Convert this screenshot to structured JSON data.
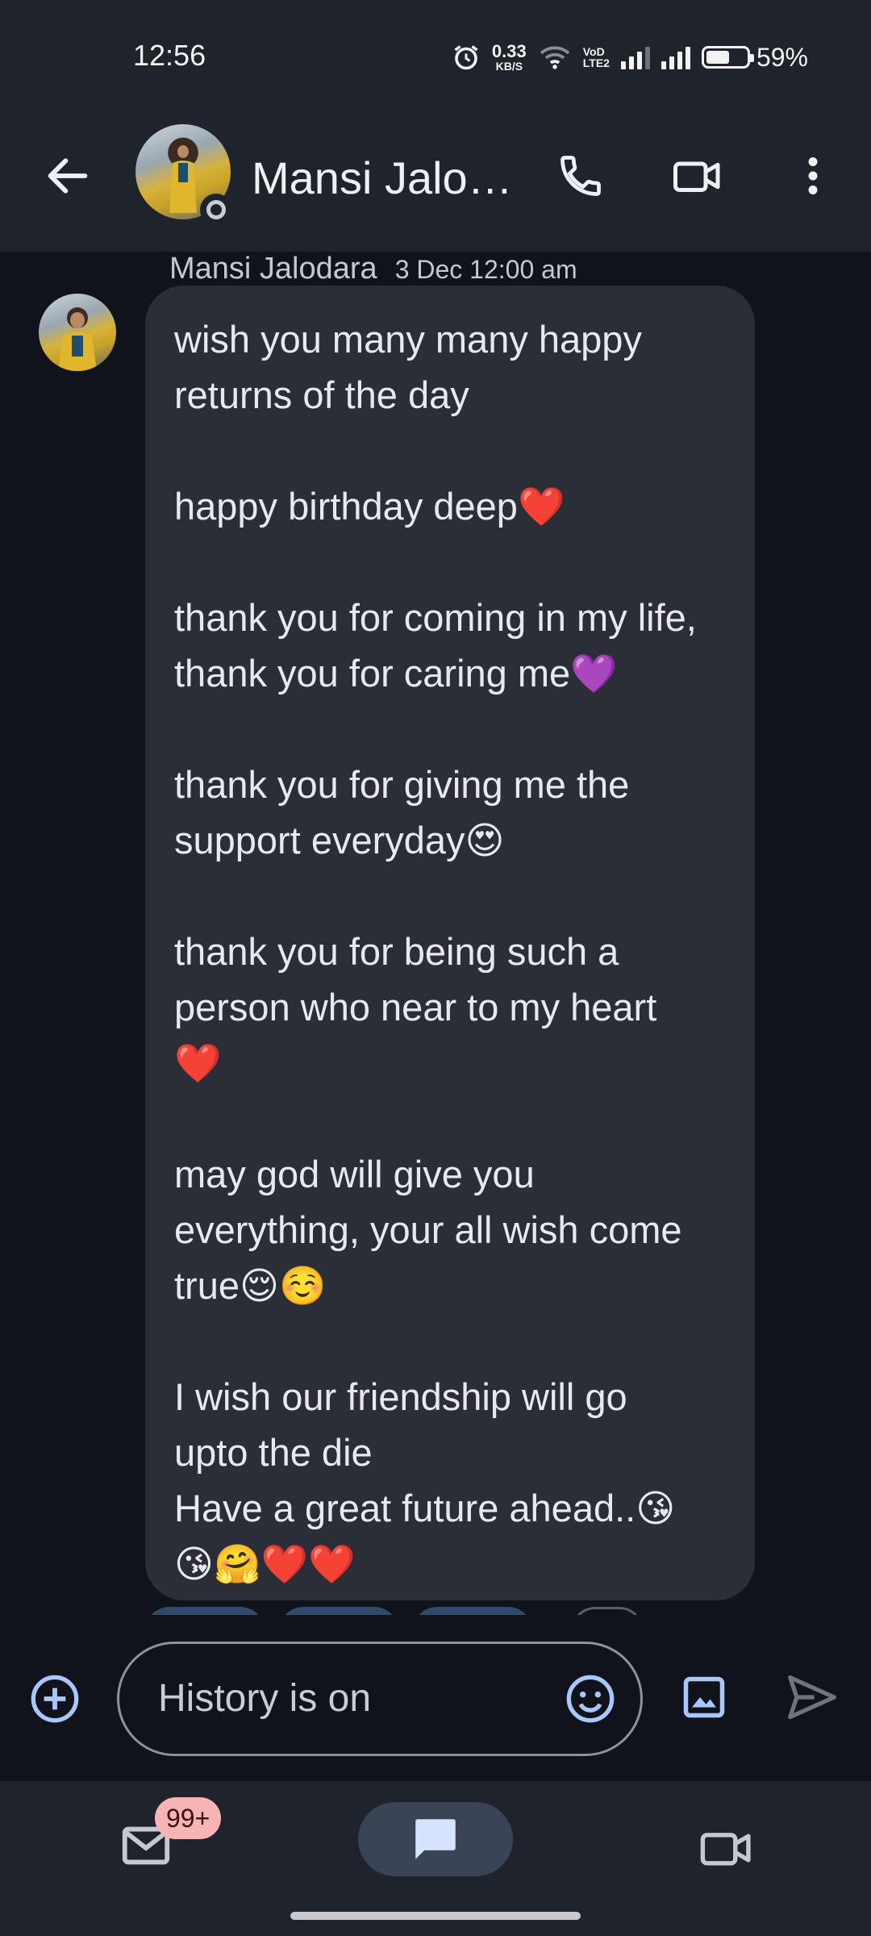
{
  "status_bar": {
    "time": "12:56",
    "net_speed_value": "0.33",
    "net_speed_unit": "KB/S",
    "volte_top": "VoD",
    "volte_bottom": "LTE2",
    "battery_percent_text": "59%",
    "battery_level": 0.59
  },
  "header": {
    "contact_name": "Mansi Jalo…",
    "back_icon": "arrow-left-icon",
    "call_icon": "phone-icon",
    "video_icon": "video-camera-icon",
    "more_icon": "more-vert-icon"
  },
  "conversation": {
    "sender_name": "Mansi Jalodara",
    "timestamp": "3 Dec 12:00 am",
    "message_lines": [
      "wish you many many happy",
      "returns of the day",
      "",
      "happy birthday deep❤️",
      "",
      "thank you for coming in my life,",
      "thank you for caring me💜",
      "",
      "thank you for giving me the",
      "support everyday😍",
      "",
      "thank you for being such a",
      "person who near to my heart",
      "❤️",
      "",
      "may god will give you",
      "everything, your all wish come",
      "true😌☺️",
      "",
      "I wish our friendship will go",
      "upto the die",
      "Have a great future ahead..😘",
      "😘🤗❤️❤️"
    ]
  },
  "compose": {
    "placeholder": "History is on",
    "add_icon": "add-circle-icon",
    "emoji_icon": "emoji-icon",
    "gallery_icon": "image-icon",
    "send_icon": "send-icon"
  },
  "bottom_nav": {
    "mail_badge": "99+",
    "mail_icon": "mail-icon",
    "chat_icon": "chat-icon",
    "meet_icon": "video-camera-icon"
  },
  "colors": {
    "background": "#10131a",
    "header": "#1f232b",
    "bubble": "#2b2e36",
    "accent": "#a8c7fa",
    "badge": "#f7b4b4"
  }
}
